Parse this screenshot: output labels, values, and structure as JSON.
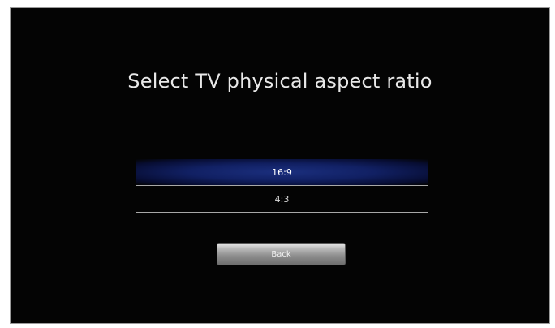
{
  "screen": {
    "title": "Select TV physical aspect ratio"
  },
  "options": [
    {
      "label": "16:9",
      "selected": true
    },
    {
      "label": "4:3",
      "selected": false
    }
  ],
  "back_button": {
    "label": "Back"
  },
  "colors": {
    "background": "#040404",
    "highlight": "#1b2f7e",
    "text": "#e8e8e8"
  }
}
